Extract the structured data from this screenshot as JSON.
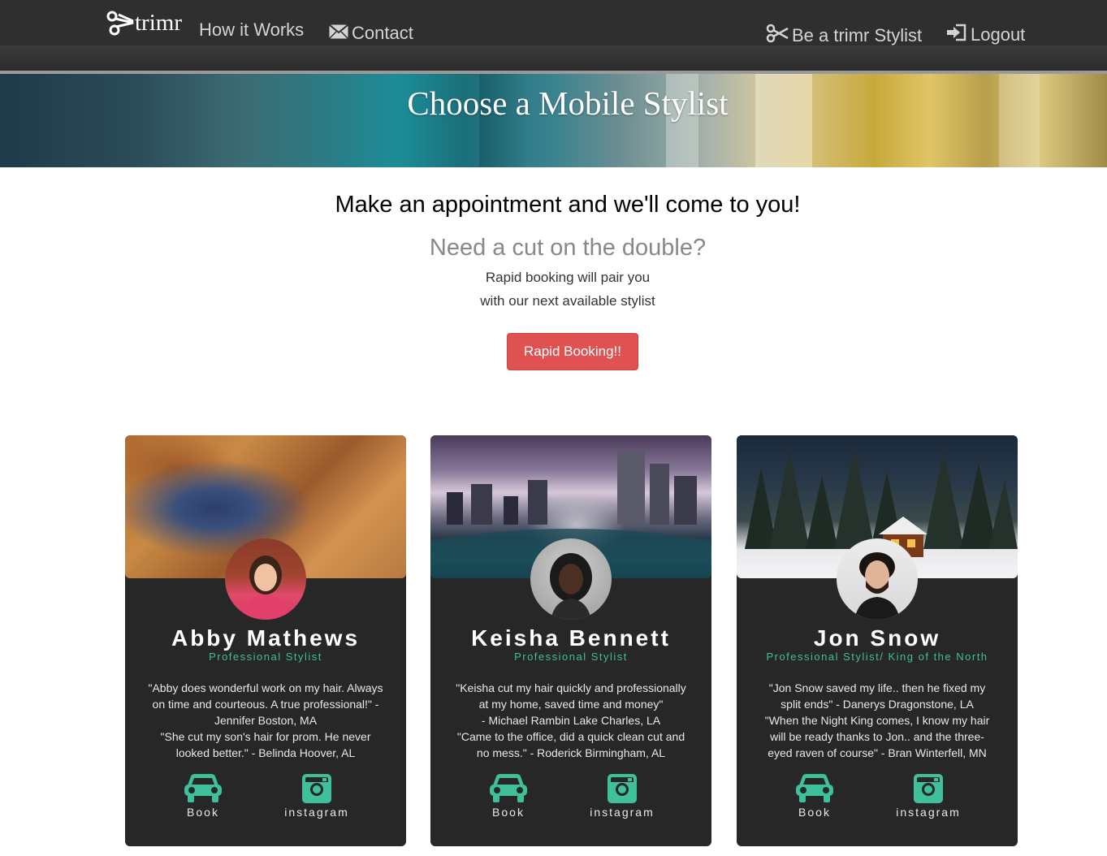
{
  "nav": {
    "brand": "trimr",
    "how_it_works": "How it Works",
    "contact": "Contact",
    "be_stylist": "Be a trimr Stylist",
    "logout": "Logout"
  },
  "hero": {
    "title": "Choose a Mobile Stylist"
  },
  "intro": {
    "heading": "Make an appointment and we'll come to you!",
    "subheading": "Need a cut on the double?",
    "line1": "Rapid booking will pair you",
    "line2": "with our next available stylist",
    "button": "Rapid Booking!!"
  },
  "colors": {
    "navbar": "#2f2f2f",
    "accent": "#3fbf9a",
    "button": "#e05252",
    "card": "#272727"
  },
  "stylists": [
    {
      "name": "Abby Mathews",
      "title": "Professional Stylist",
      "review_lines": [
        "\"Abby does wonderful work on my hair. Always",
        "on time and courteous. A true professional!\" -",
        "Jennifer Boston, MA",
        "\"She cut my son's hair for prom. He never",
        "looked better.\" - Belinda Hoover, AL"
      ],
      "book": "Book",
      "instagram": "instagram"
    },
    {
      "name": "Keisha Bennett",
      "title": "Professional Stylist",
      "review_lines": [
        "\"Keisha cut my hair quickly and professionally",
        "at my home, saved time and money\"",
        "- Michael Rambin Lake Charles, LA",
        "\"Came to the office, did a quick clean cut and",
        "no mess.\" - Roderick Birmingham, AL"
      ],
      "book": "Book",
      "instagram": "instagram"
    },
    {
      "name": "Jon Snow",
      "title": "Professional Stylist/ King of the North",
      "review_lines": [
        "\"Jon Snow saved my life.. then he fixed my",
        "split ends\" - Danerys Dragonstone, LA",
        "\"When the Night King comes, I know my hair",
        "will be ready thanks to Jon.. and the three-",
        "eyed raven of course\" - Bran Winterfell, MN"
      ],
      "book": "Book",
      "instagram": "instagram"
    }
  ]
}
